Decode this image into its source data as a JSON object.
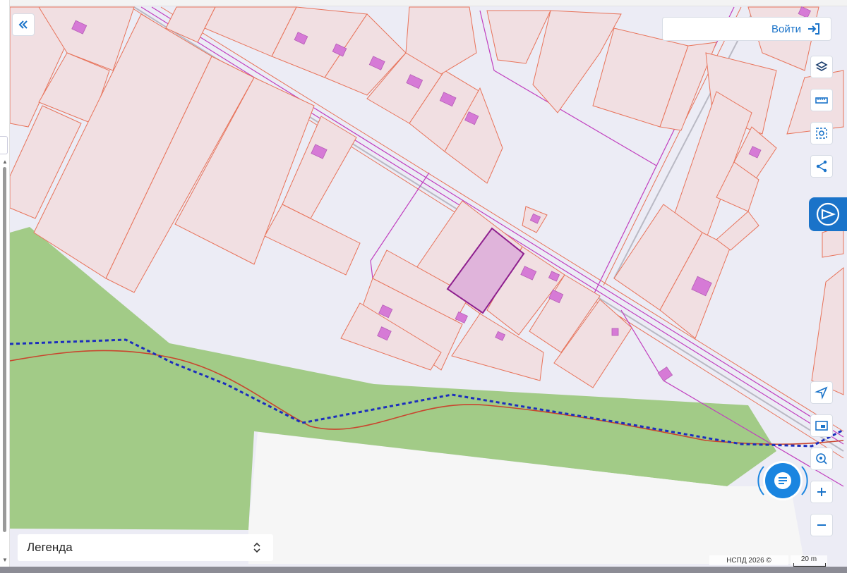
{
  "header": {
    "login_label": "Войти"
  },
  "legend": {
    "label": "Легенда"
  },
  "footer": {
    "copyright": "НСПД 2026 ©",
    "scale_label": "20 m"
  },
  "icons": {
    "collapse": "double-chevron-left-icon",
    "login": "sign-in-icon",
    "layers": "layers-icon",
    "measure": "ruler-icon",
    "select": "area-select-icon",
    "share": "share-icon",
    "pkk": "cadastral-map-icon",
    "locate": "locate-arrow-icon",
    "minimap": "minimap-icon",
    "search": "geo-search-icon",
    "zoom_in": "plus-icon",
    "zoom_out": "minus-icon",
    "chat": "chat-icon",
    "legend_toggle": "chevron-updown-icon"
  },
  "colors": {
    "map_background": "#ececf5",
    "parcel_fill": "#f1dfe2",
    "parcel_stroke": "#e8735a",
    "building_fill": "#d67ad6",
    "selected_parcel_fill": "#e0b4db",
    "selected_parcel_stroke": "#8e1f8e",
    "forest_fill": "#a2cb87",
    "boundary_blue": "#1c2ebd",
    "river_red": "#c9452e",
    "accent": "#1a73c9"
  }
}
